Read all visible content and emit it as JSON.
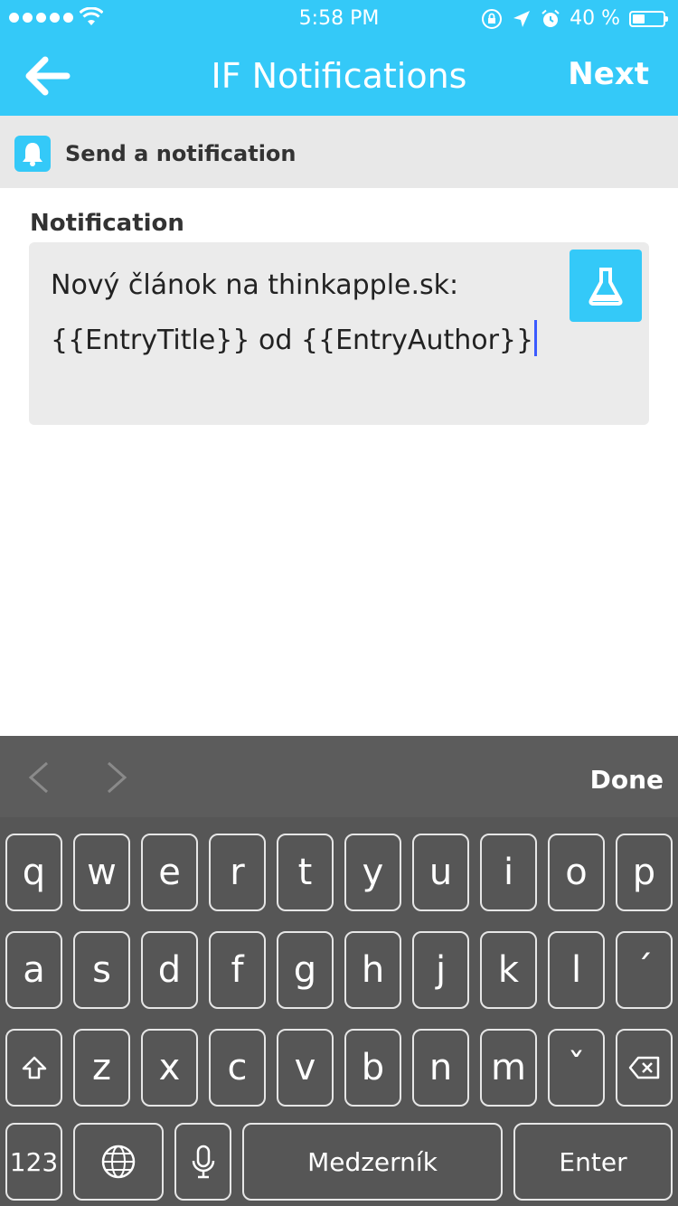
{
  "status_bar": {
    "time": "5:58 PM",
    "battery_text": "40 %",
    "battery_level": 0.4,
    "icons": [
      "signal-dots-icon",
      "wifi-icon",
      "orientation-lock-icon",
      "location-arrow-icon",
      "alarm-icon",
      "battery-icon"
    ]
  },
  "nav": {
    "title": "IF Notifications",
    "next_label": "Next",
    "back_icon": "back-arrow-icon"
  },
  "action": {
    "label": "Send a notification",
    "icon": "bell-icon"
  },
  "field": {
    "label": "Notification",
    "line1": "Nový článok na thinkapple.sk:",
    "line2": "{{EntryTitle}} od {{EntryAuthor}}",
    "ingredient_icon": "flask-icon"
  },
  "keyboard": {
    "done_label": "Done",
    "row1": [
      "q",
      "w",
      "e",
      "r",
      "t",
      "y",
      "u",
      "i",
      "o",
      "p"
    ],
    "row2": [
      "a",
      "s",
      "d",
      "f",
      "g",
      "h",
      "j",
      "k",
      "l",
      "´"
    ],
    "row3": [
      "z",
      "x",
      "c",
      "v",
      "b",
      "n",
      "m",
      "ˇ"
    ],
    "numbers_label": "123",
    "space_label": "Medzerník",
    "enter_label": "Enter"
  },
  "colors": {
    "accent": "#34c9f8",
    "keyboard_bg": "#565656",
    "cursor": "#3b5bff"
  }
}
